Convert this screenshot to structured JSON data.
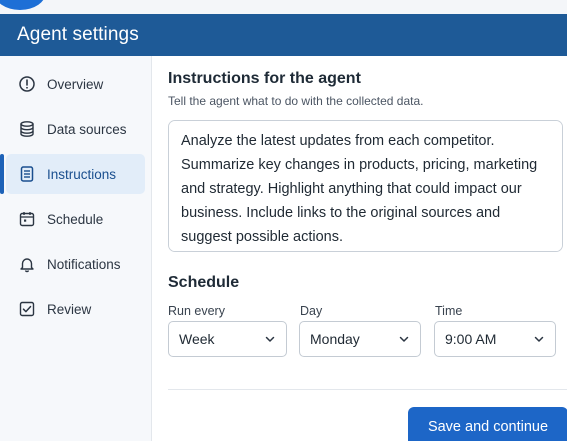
{
  "header": {
    "title": "Agent settings"
  },
  "sidebar": {
    "items": [
      {
        "label": "Overview",
        "icon": "info-icon",
        "active": false
      },
      {
        "label": "Data sources",
        "icon": "database-icon",
        "active": false
      },
      {
        "label": "Instructions",
        "icon": "document-icon",
        "active": true
      },
      {
        "label": "Schedule",
        "icon": "calendar-icon",
        "active": false
      },
      {
        "label": "Notifications",
        "icon": "bell-icon",
        "active": false
      },
      {
        "label": "Review",
        "icon": "checkbox-icon",
        "active": false
      }
    ]
  },
  "instructions": {
    "title": "Instructions for the agent",
    "subtitle": "Tell the agent what to do with the collected data.",
    "text": "Analyze the latest updates from each competitor. Summarize key changes in products, pricing, marketing and strategy. Highlight anything that could impact our business. Include links to the original sources and suggest possible actions."
  },
  "schedule": {
    "title": "Schedule",
    "run_every": {
      "label": "Run every",
      "value": "Week"
    },
    "day": {
      "label": "Day",
      "value": "Monday"
    },
    "time": {
      "label": "Time",
      "value": "9:00 AM"
    }
  },
  "footer": {
    "save_label": "Save and continue"
  },
  "colors": {
    "header": "#1e5a97",
    "accent": "#1d66c7",
    "active_bg": "#e2edf9"
  }
}
